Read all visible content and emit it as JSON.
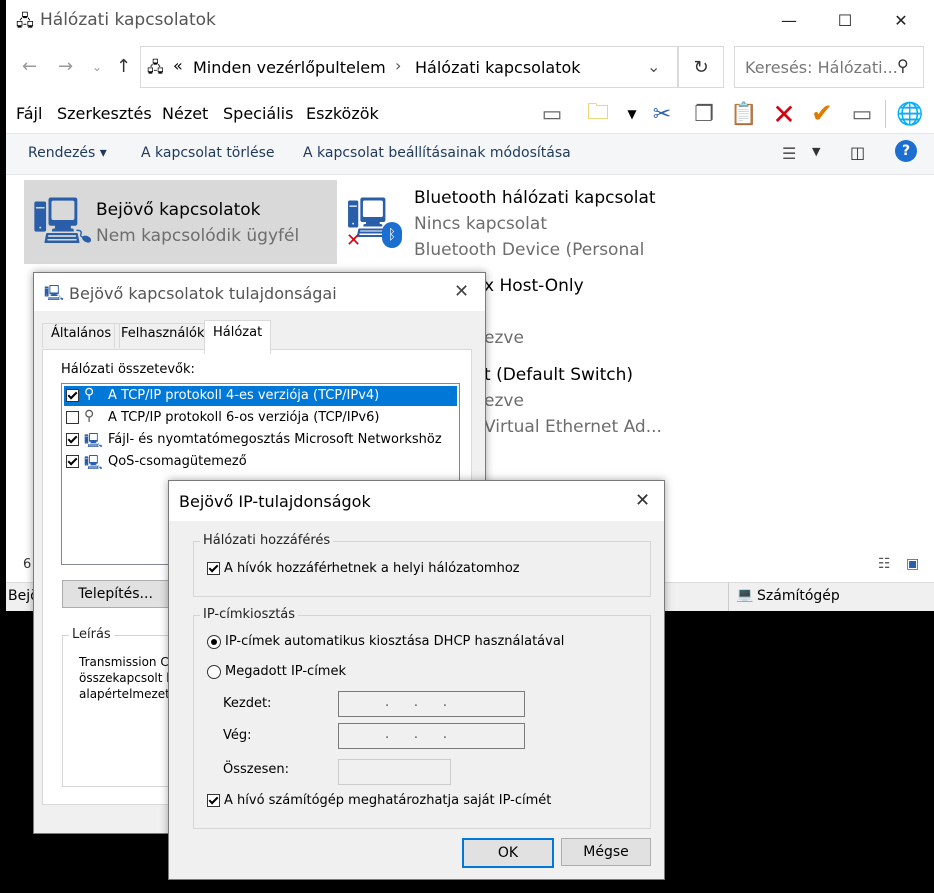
{
  "explorer": {
    "title": "Hálózati kapcsolatok",
    "address": {
      "overflow": "«",
      "crumb1": "Minden vezérlőpultelem",
      "sep": "›",
      "crumb2": "Hálózati kapcsolatok"
    },
    "search_placeholder": "Keresés: Hálózati...",
    "menu": [
      "Fájl",
      "Szerkesztés",
      "Nézet",
      "Speciális",
      "Eszközök"
    ],
    "commands": {
      "organize": "Rendezés ▾",
      "delete": "A kapcsolat törlése",
      "change": "A kapcsolat beállításainak módosítása"
    },
    "items": [
      {
        "title": "Bejövő kapcsolatok",
        "sub1": "Nem kapcsolódik ügyfél",
        "sub2": ""
      },
      {
        "title": "Bluetooth hálózati kapcsolat",
        "sub1": "Nincs kapcsolat",
        "sub2": "Bluetooth Device (Personal ..."
      },
      {
        "title": "x Host-Only",
        "sub1": "ezve",
        "sub2": ""
      },
      {
        "title": "t (Default Switch)",
        "sub1": "ezve",
        "sub2": "Virtual Ethernet Ad..."
      }
    ],
    "count_partial": "6",
    "status_left": "Bejö",
    "status_right": "Számítógép"
  },
  "props": {
    "title": "Bejövő kapcsolatok tulajdonságai",
    "tabs": [
      "Általános",
      "Felhasználók",
      "Hálózat"
    ],
    "components_label": "Hálózati összetevők:",
    "components": [
      {
        "label": "A TCP/IP protokoll 4-es verziója (TCP/IPv4)",
        "checked": true,
        "selected": true
      },
      {
        "label": "A TCP/IP protokoll 6-os verziója (TCP/IPv6)",
        "checked": false,
        "selected": false
      },
      {
        "label": "Fájl- és nyomtatómegosztás Microsoft Networkshöz",
        "checked": true,
        "selected": false
      },
      {
        "label": "QoS-csomagütemező",
        "checked": true,
        "selected": false
      }
    ],
    "install_button": "Telepítés...",
    "desc_label": "Leírás",
    "desc_lines": [
      "Transmission C",
      "összekapcsolt h",
      "alapértelmezett"
    ]
  },
  "ipdlg": {
    "title": "Bejövő IP-tulajdonságok",
    "access_group": "Hálózati hozzáférés",
    "access_check": "A hívók hozzáférhetnek a helyi hálózatomhoz",
    "ip_group": "IP-címkiosztás",
    "radio_dhcp": "IP-címek automatikus kiosztása DHCP használatával",
    "radio_manual": "Megadott IP-címek",
    "start_label": "Kezdet:",
    "end_label": "Vég:",
    "total_label": "Összesen:",
    "ip_dots": ".      .      .",
    "client_check": "A hívó számítógép meghatározhatja saját IP-címét",
    "ok": "OK",
    "cancel": "Mégse"
  },
  "colors": {
    "selection": "#0078d7",
    "link_text": "#1e395b",
    "red_x": "#d9000f",
    "check_orange": "#e07b00"
  }
}
